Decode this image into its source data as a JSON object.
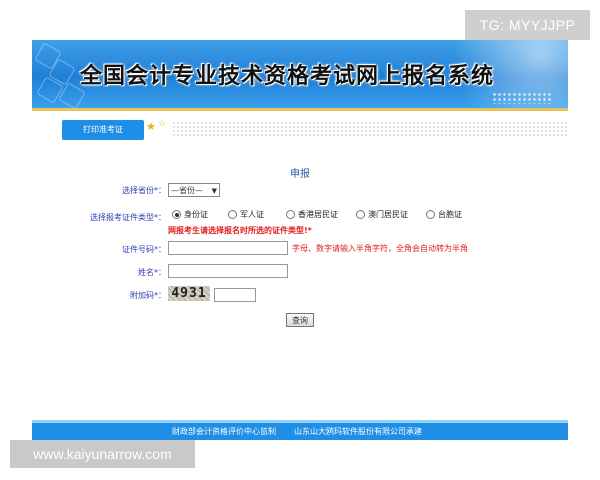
{
  "banner": {
    "title": "全国会计专业技术资格考试网上报名系统"
  },
  "toolbar": {
    "print_label": "打印准考证"
  },
  "form": {
    "section_title": "申报",
    "province_label": "选择省份*：",
    "province_value": "—省份—",
    "id_type_label": "选择报考证件类型*：",
    "id_types": [
      "身份证",
      "军人证",
      "香港居民证",
      "澳门居民证",
      "台胞证"
    ],
    "id_type_selected_index": 0,
    "warning": "网报考生请选择报名时所选的证件类型!*",
    "id_number_label": "证件号码*：",
    "id_number_value": "",
    "id_number_hint": "字母、数字请输入半角字符，全角会自动转为半角",
    "name_label": "姓名*：",
    "name_value": "",
    "captcha_label": "附加码*：",
    "captcha_text": "4931",
    "captcha_value": "",
    "query_label": "查询"
  },
  "footer": {
    "supervisor": "财政部会计资格评价中心监制",
    "builder": "山东山大鸥玛软件股份有限公司承建"
  },
  "watermarks": {
    "top_right": "TG: MYYJJPP",
    "bottom_left": "www.kaiyunarrow.com"
  },
  "colors": {
    "banner_blue": "#1f7fd6",
    "footer_blue": "#1e8ee6",
    "label_blue": "#3040b0",
    "warning_red": "#e02020",
    "gold": "#e8c25a"
  }
}
